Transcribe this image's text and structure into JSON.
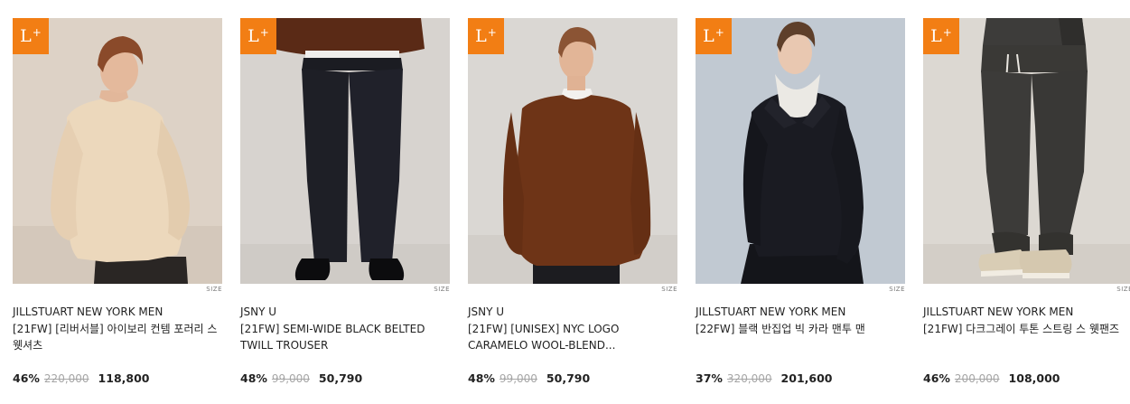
{
  "badge": {
    "letter": "L",
    "plus": "+",
    "color": "#f27e14"
  },
  "size_label": "SIZE",
  "products": [
    {
      "brand": "JILLSTUART NEW YORK MEN",
      "title": "[21FW] [리버서블] 아이보리 컨템 포러리 스웻셔츠",
      "discount": "46%",
      "original": "220,000",
      "price": "118,800"
    },
    {
      "brand": "JSNY U",
      "title": "[21FW] SEMI-WIDE BLACK BELTED TWILL TROUSER",
      "discount": "48%",
      "original": "99,000",
      "price": "50,790"
    },
    {
      "brand": "JSNY U",
      "title": "[21FW] [UNISEX] NYC LOGO CARAMELO WOOL-BLEND...",
      "discount": "48%",
      "original": "99,000",
      "price": "50,790"
    },
    {
      "brand": "JILLSTUART NEW YORK MEN",
      "title": "[22FW] 블랙 반집업 빅 카라 맨투 맨",
      "discount": "37%",
      "original": "320,000",
      "price": "201,600"
    },
    {
      "brand": "JILLSTUART NEW YORK MEN",
      "title": "[21FW] 다크그레이 투톤 스트링 스 웻팬즈",
      "discount": "46%",
      "original": "200,000",
      "price": "108,000"
    }
  ]
}
